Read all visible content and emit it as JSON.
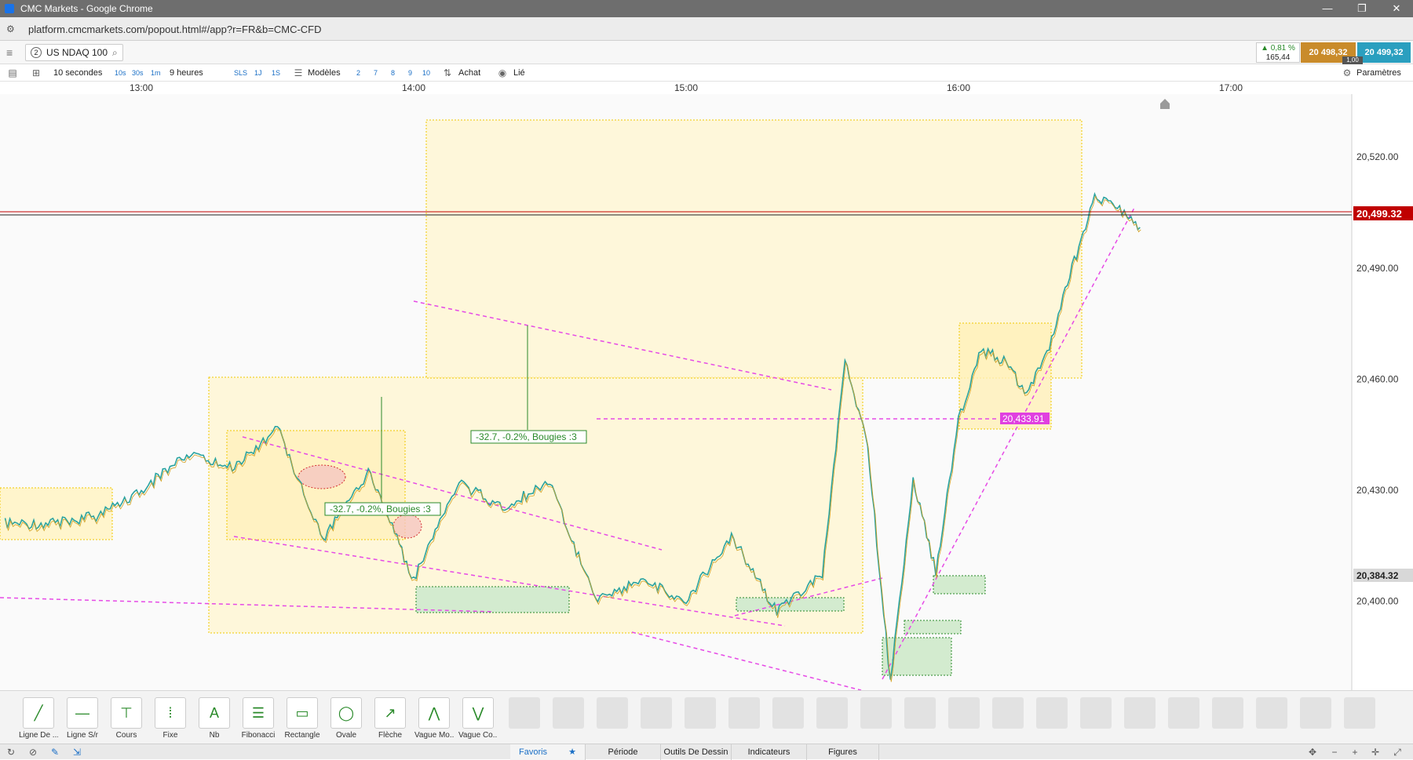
{
  "window": {
    "title": "CMC Markets - Google Chrome",
    "controls": [
      "—",
      "❐",
      "✕"
    ]
  },
  "address": {
    "url": "platform.cmcmarkets.com/popout.html#/app?r=FR&b=CMC-CFD"
  },
  "instrument": {
    "number": "2",
    "name": "US NDAQ 100",
    "change_pct": "0,81 %",
    "change_pts": "165,44",
    "sell_price": "20 498,32",
    "buy_price": "20 499,32",
    "spread": "1,00"
  },
  "toolbar": {
    "interval": "10 secondes",
    "intervals": [
      "10s",
      "30s",
      "1m"
    ],
    "range": "9 heures",
    "ranges": [
      "SLS",
      "1J",
      "1S"
    ],
    "templates": "Modèles",
    "numbers": [
      "2",
      "7",
      "8",
      "9",
      "10"
    ],
    "buy": "Achat",
    "linked": "Lié",
    "settings": "Paramètres"
  },
  "time_axis": {
    "ticks": [
      "13:00",
      "14:00",
      "15:00",
      "16:00",
      "17:00"
    ]
  },
  "chart_data": {
    "type": "line",
    "instrument": "US NDAQ 100",
    "y_ticks": [
      "20,520.00",
      "20,490.00",
      "20,460.00",
      "20,430.00",
      "20,400.00"
    ],
    "ylim": [
      20376,
      20537
    ],
    "current_price": "20,499.32",
    "low_marker": "20,384.32",
    "level_label": "20,433.91",
    "measure_labels": [
      "-32.7, -0.2%, Bougies :3",
      "-32.7, -0.2%, Bougies :3"
    ],
    "colors": {
      "up": "#2aa3a0",
      "down": "#d4a020",
      "current": "#c00000",
      "level": "#e040e0",
      "zone": "#fff3c4",
      "demand": "#cde8c8",
      "trend": "#e64ae6"
    },
    "x_range": [
      "12:30",
      "17:30"
    ],
    "series": [
      {
        "x": [
          "12:30",
          "12:40",
          "12:50",
          "13:00",
          "13:10",
          "13:20",
          "13:30",
          "13:40",
          "13:50",
          "14:00",
          "14:10",
          "14:20",
          "14:30",
          "14:40",
          "14:50",
          "15:00",
          "15:10",
          "15:20",
          "15:30",
          "15:35",
          "15:40",
          "15:45",
          "15:50",
          "15:55",
          "16:00",
          "16:05",
          "16:10",
          "16:15",
          "16:20",
          "16:25",
          "16:30",
          "16:35",
          "16:40"
        ],
        "values": [
          20421,
          20421,
          20423,
          20430,
          20440,
          20436,
          20447,
          20417,
          20435,
          20406,
          20432,
          20425,
          20433,
          20400,
          20406,
          20400,
          20418,
          20397,
          20407,
          20465,
          20442,
          20378,
          20433,
          20408,
          20449,
          20468,
          20465,
          20456,
          20468,
          20490,
          20509,
          20506,
          20501
        ]
      }
    ]
  },
  "drawing_tools": [
    {
      "name": "line-tool",
      "label": "Ligne De ..."
    },
    {
      "name": "sr-line-tool",
      "label": "Ligne S/r"
    },
    {
      "name": "price-tool",
      "label": "Cours"
    },
    {
      "name": "fixed-tool",
      "label": "Fixe"
    },
    {
      "name": "note-tool",
      "label": "Nb"
    },
    {
      "name": "fibonacci-tool",
      "label": "Fibonacci"
    },
    {
      "name": "rectangle-tool",
      "label": "Rectangle"
    },
    {
      "name": "oval-tool",
      "label": "Ovale"
    },
    {
      "name": "arrow-tool",
      "label": "Flèche"
    },
    {
      "name": "wave-tool-1",
      "label": "Vague Mo..."
    },
    {
      "name": "wave-tool-2",
      "label": "Vague Co..."
    }
  ],
  "bottom_tabs": [
    "Favoris",
    "Période",
    "Outils De Dessin",
    "Indicateurs",
    "Figures"
  ]
}
